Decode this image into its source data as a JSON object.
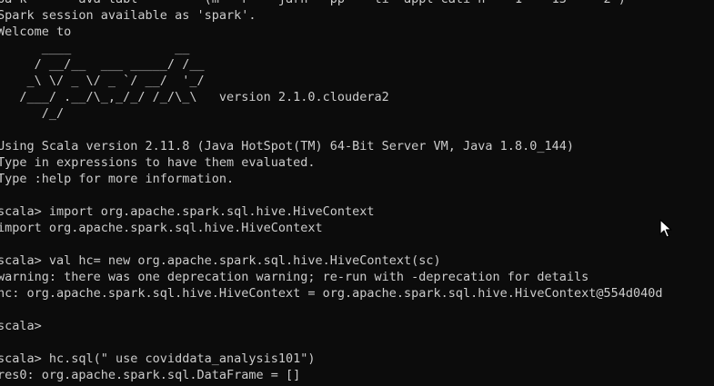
{
  "terminal": {
    "lines": [
      "pa k       ava labl         (m   r    jarn   pp    ti  appl cati n    1    13     2 )",
      "Spark session available as 'spark'.",
      "Welcome to",
      "      ____              __",
      "     / __/__  ___ _____/ /__",
      "    _\\ \\/ _ \\/ _ `/ __/  '_/",
      "   /___/ .__/\\_,_/_/ /_/\\_\\   version 2.1.0.cloudera2",
      "      /_/",
      "",
      "Using Scala version 2.11.8 (Java HotSpot(TM) 64-Bit Server VM, Java 1.8.0_144)",
      "Type in expressions to have them evaluated.",
      "Type :help for more information.",
      "",
      "scala> import org.apache.spark.sql.hive.HiveContext",
      "import org.apache.spark.sql.hive.HiveContext",
      "",
      "scala> val hc= new org.apache.spark.sql.hive.HiveContext(sc)",
      "warning: there was one deprecation warning; re-run with -deprecation for details",
      "hc: org.apache.spark.sql.hive.HiveContext = org.apache.spark.sql.hive.HiveContext@554d040d",
      "",
      "scala>",
      "",
      "scala> hc.sql(\" use coviddata_analysis101\")",
      "res0: org.apache.spark.sql.DataFrame = []"
    ]
  },
  "colors": {
    "background": "#0c0c0c",
    "text": "#cccccc"
  },
  "icons": {
    "mouse_pointer": "arrow-cursor-icon"
  }
}
